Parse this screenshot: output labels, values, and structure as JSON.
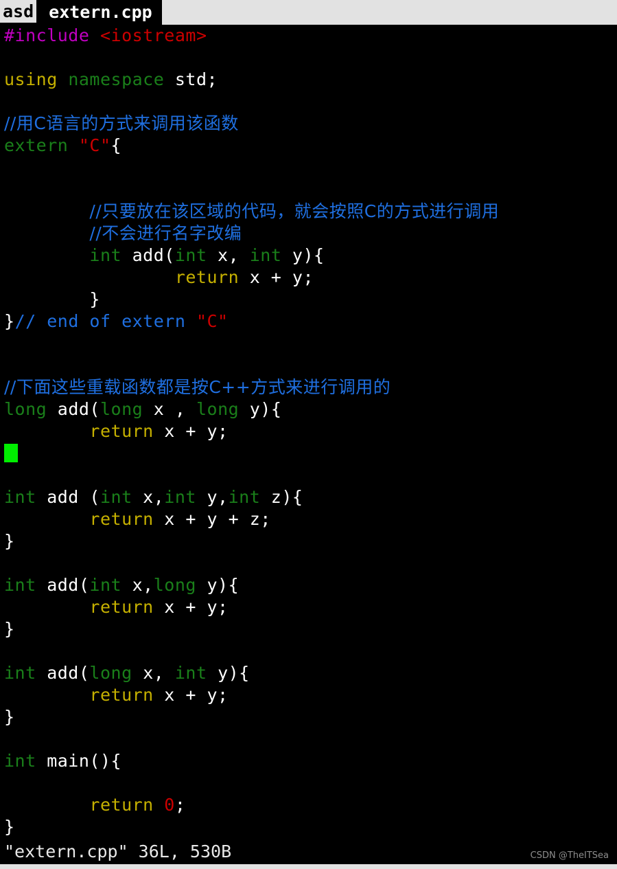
{
  "editor": {
    "name": "vim",
    "background": "#000000",
    "foreground": "#dedede"
  },
  "tabline": {
    "tabs": [
      {
        "label": "asd",
        "active": false
      },
      {
        "label": "extern.cpp",
        "active": true
      }
    ]
  },
  "colors": {
    "comment": "#1f6fe0",
    "preproc": "#c000c0",
    "string": "#cc0000",
    "type": "#1a7f1a",
    "statement": "#c5b000",
    "number": "#cc0000",
    "normal_text": "#ffffff",
    "tilde": "#2a7fe0",
    "cursor": "#00ee00",
    "tab_inactive_bg": "#e2e2e2",
    "tab_active_bg": "#000000"
  },
  "cursor": {
    "line_index": 19,
    "column": 0,
    "shape": "block",
    "color": "#00ee00"
  },
  "buffer": {
    "filename": "extern.cpp",
    "lines": [
      {
        "t": "#include <iostream>",
        "segs": [
          {
            "c": "pre",
            "s": "#include"
          },
          {
            "c": "text",
            "s": " "
          },
          {
            "c": "string",
            "s": "<iostream>"
          }
        ]
      },
      {
        "t": "",
        "segs": []
      },
      {
        "t": "using namespace std;",
        "segs": [
          {
            "c": "stmt",
            "s": "using"
          },
          {
            "c": "text",
            "s": " "
          },
          {
            "c": "type",
            "s": "namespace"
          },
          {
            "c": "text",
            "s": " std;"
          }
        ]
      },
      {
        "t": "",
        "segs": []
      },
      {
        "t": "//用C语言的方式来调用该函数",
        "segs": [
          {
            "c": "comment",
            "s": "//用C语言的方式来调用该函数",
            "cjk": true
          }
        ]
      },
      {
        "t": "extern \"C\"{",
        "segs": [
          {
            "c": "type",
            "s": "extern"
          },
          {
            "c": "text",
            "s": " "
          },
          {
            "c": "string",
            "s": "\"C\""
          },
          {
            "c": "text",
            "s": "{"
          }
        ]
      },
      {
        "t": "",
        "segs": []
      },
      {
        "t": "",
        "segs": []
      },
      {
        "t": "        //只要放在该区域的代码，就会按照C的方式进行调用",
        "segs": [
          {
            "c": "text",
            "s": "        "
          },
          {
            "c": "comment",
            "s": "//只要放在该区域的代码，就会按照C的方式进行调用",
            "cjk": true
          }
        ]
      },
      {
        "t": "        //不会进行名字改编",
        "segs": [
          {
            "c": "text",
            "s": "        "
          },
          {
            "c": "comment",
            "s": "//不会进行名字改编",
            "cjk": true
          }
        ]
      },
      {
        "t": "        int add(int x, int y){",
        "segs": [
          {
            "c": "text",
            "s": "        "
          },
          {
            "c": "type",
            "s": "int"
          },
          {
            "c": "text",
            "s": " add("
          },
          {
            "c": "type",
            "s": "int"
          },
          {
            "c": "text",
            "s": " x, "
          },
          {
            "c": "type",
            "s": "int"
          },
          {
            "c": "text",
            "s": " y){"
          }
        ]
      },
      {
        "t": "                return x + y;",
        "segs": [
          {
            "c": "text",
            "s": "                "
          },
          {
            "c": "stmt",
            "s": "return"
          },
          {
            "c": "text",
            "s": " x + y;"
          }
        ]
      },
      {
        "t": "        }",
        "segs": [
          {
            "c": "text",
            "s": "        }"
          }
        ]
      },
      {
        "t": "}// end of extern \"C\"",
        "segs": [
          {
            "c": "text",
            "s": "}"
          },
          {
            "c": "comment",
            "s": "// end of extern "
          },
          {
            "c": "string",
            "s": "\"C\""
          }
        ]
      },
      {
        "t": "",
        "segs": []
      },
      {
        "t": "",
        "segs": []
      },
      {
        "t": "//下面这些重载函数都是按C++方式来进行调用的",
        "segs": [
          {
            "c": "comment",
            "s": "//下面这些重载函数都是按C++方式来进行调用的",
            "cjk": true
          }
        ]
      },
      {
        "t": "long add(long x , long y){",
        "segs": [
          {
            "c": "type",
            "s": "long"
          },
          {
            "c": "text",
            "s": " add("
          },
          {
            "c": "type",
            "s": "long"
          },
          {
            "c": "text",
            "s": " x , "
          },
          {
            "c": "type",
            "s": "long"
          },
          {
            "c": "text",
            "s": " y){"
          }
        ]
      },
      {
        "t": "        return x + y;",
        "segs": [
          {
            "c": "text",
            "s": "        "
          },
          {
            "c": "stmt",
            "s": "return"
          },
          {
            "c": "text",
            "s": " x + y;"
          }
        ]
      },
      {
        "t": "}",
        "segs": [
          {
            "c": "text",
            "s": "}"
          }
        ]
      },
      {
        "t": "",
        "segs": []
      },
      {
        "t": "int add (int x,int y,int z){",
        "segs": [
          {
            "c": "type",
            "s": "int"
          },
          {
            "c": "text",
            "s": " add ("
          },
          {
            "c": "type",
            "s": "int"
          },
          {
            "c": "text",
            "s": " x,"
          },
          {
            "c": "type",
            "s": "int"
          },
          {
            "c": "text",
            "s": " y,"
          },
          {
            "c": "type",
            "s": "int"
          },
          {
            "c": "text",
            "s": " z){"
          }
        ]
      },
      {
        "t": "        return x + y + z;",
        "segs": [
          {
            "c": "text",
            "s": "        "
          },
          {
            "c": "stmt",
            "s": "return"
          },
          {
            "c": "text",
            "s": " x + y + z;"
          }
        ]
      },
      {
        "t": "}",
        "segs": [
          {
            "c": "text",
            "s": "}"
          }
        ]
      },
      {
        "t": "",
        "segs": []
      },
      {
        "t": "int add(int x,long y){",
        "segs": [
          {
            "c": "type",
            "s": "int"
          },
          {
            "c": "text",
            "s": " add("
          },
          {
            "c": "type",
            "s": "int"
          },
          {
            "c": "text",
            "s": " x,"
          },
          {
            "c": "type",
            "s": "long"
          },
          {
            "c": "text",
            "s": " y){"
          }
        ]
      },
      {
        "t": "        return x + y;",
        "segs": [
          {
            "c": "text",
            "s": "        "
          },
          {
            "c": "stmt",
            "s": "return"
          },
          {
            "c": "text",
            "s": " x + y;"
          }
        ]
      },
      {
        "t": "}",
        "segs": [
          {
            "c": "text",
            "s": "}"
          }
        ]
      },
      {
        "t": "",
        "segs": []
      },
      {
        "t": "int add(long x, int y){",
        "segs": [
          {
            "c": "type",
            "s": "int"
          },
          {
            "c": "text",
            "s": " add("
          },
          {
            "c": "type",
            "s": "long"
          },
          {
            "c": "text",
            "s": " x, "
          },
          {
            "c": "type",
            "s": "int"
          },
          {
            "c": "text",
            "s": " y){"
          }
        ]
      },
      {
        "t": "        return x + y;",
        "segs": [
          {
            "c": "text",
            "s": "        "
          },
          {
            "c": "stmt",
            "s": "return"
          },
          {
            "c": "text",
            "s": " x + y;"
          }
        ]
      },
      {
        "t": "}",
        "segs": [
          {
            "c": "text",
            "s": "}"
          }
        ]
      },
      {
        "t": "",
        "segs": []
      },
      {
        "t": "int main(){",
        "segs": [
          {
            "c": "type",
            "s": "int"
          },
          {
            "c": "text",
            "s": " main(){"
          }
        ]
      },
      {
        "t": "",
        "segs": []
      },
      {
        "t": "        return 0;",
        "segs": [
          {
            "c": "text",
            "s": "        "
          },
          {
            "c": "stmt",
            "s": "return"
          },
          {
            "c": "text",
            "s": " "
          },
          {
            "c": "number",
            "s": "0"
          },
          {
            "c": "text",
            "s": ";"
          }
        ]
      },
      {
        "t": "}",
        "segs": [
          {
            "c": "text",
            "s": "}"
          }
        ]
      },
      {
        "t": "~",
        "segs": [
          {
            "c": "tilde",
            "s": "~"
          }
        ]
      }
    ]
  },
  "statusline": {
    "text": "\"extern.cpp\" 36L, 530B",
    "file_label": "\"extern.cpp\"",
    "line_count": "36L",
    "byte_count": "530B"
  },
  "watermark": {
    "text": "CSDN @TheITSea"
  }
}
